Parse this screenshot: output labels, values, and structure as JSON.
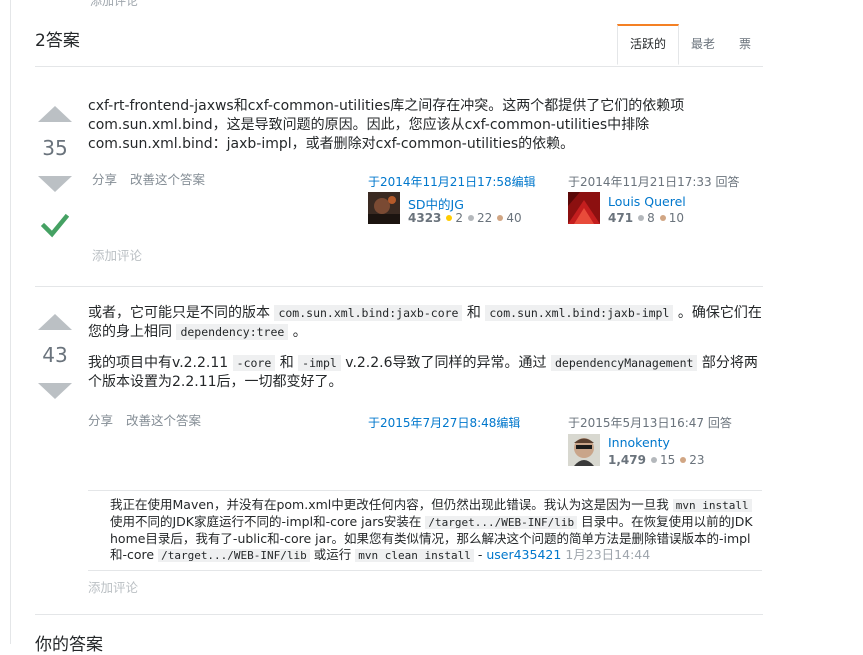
{
  "top_cut": "添加评论",
  "answers_header": {
    "count": "2答案",
    "tabs": [
      {
        "label": "活跃的",
        "active": true
      },
      {
        "label": "最老",
        "active": false
      },
      {
        "label": "票",
        "active": false
      }
    ]
  },
  "answers": [
    {
      "votes": "35",
      "accepted": true,
      "body": "cxf-rt-frontend-jaxws和cxf-common-utilities库之间存在冲突。这两个都提供了它们的依赖项com.sun.xml.bind，这是导致问题的原因。因此，您应该从cxf-common-utilities中排除com.sun.xml.bind：jaxb-impl，或者删除对cxf-common-utilities的依赖。",
      "menu": {
        "share": "分享",
        "improve": "改善这个答案"
      },
      "edited": {
        "label": "于2014年11月21日17:58编辑",
        "user": "SD中的JG",
        "rep": "4323",
        "gold": "2",
        "silver": "22",
        "bronze": "40"
      },
      "answered": {
        "label": "于2014年11月21日17:33 回答",
        "user": "Louis Querel",
        "rep": "471",
        "silver": "8",
        "bronze": "10"
      },
      "add_comment": "添加评论"
    },
    {
      "votes": "43",
      "accepted": false,
      "p1": {
        "t1": "或者，它可能只是不同的版本",
        "c1": "com.sun.xml.bind:jaxb-core",
        "t2": "和",
        "c2": "com.sun.xml.bind:jaxb-impl",
        "t3": "。确保它们在您的身上相同",
        "c3": "dependency:tree",
        "t4": "。"
      },
      "p2": {
        "t1": "我的项目中有v.2.2.11",
        "c1": "-core",
        "t2": "和",
        "c2": "-impl",
        "t3": "v.2.2.6导致了同样的异常。通过",
        "c3": "dependencyManagement",
        "t4": "部分将两个版本设置为2.2.11后，一切都变好了。"
      },
      "menu": {
        "share": "分享",
        "improve": "改善这个答案"
      },
      "edited": {
        "label": "于2015年7月27日8:48编辑"
      },
      "answered": {
        "label": "于2015年5月13日16:47 回答",
        "user": "Innokenty",
        "rep": "1,479",
        "silver": "15",
        "bronze": "23"
      },
      "comment": {
        "t1": "我正在使用Maven，并没有在pom.xml中更改任何内容，但仍然出现此错误。我认为这是因为一旦我",
        "c1": "mvn install",
        "t2": "使用不同的JDK家庭运行不同的-impl和-core jars安装在",
        "c2": "/target.../WEB-INF/lib",
        "t3": "目录中。在恢复使用以前的JDK home目录后，我有了-ublic和-core jar。如果您有类似情况，那么解决这个问题的简单方法是删除错误版本的-impl和-core",
        "c3": "/target.../WEB-INF/lib",
        "t4": "或运行",
        "c4": "mvn clean install",
        "dash": "-",
        "user": "user435421",
        "date": "1月23日14:44"
      },
      "add_comment": "添加评论"
    }
  ],
  "your_answer": "你的答案"
}
